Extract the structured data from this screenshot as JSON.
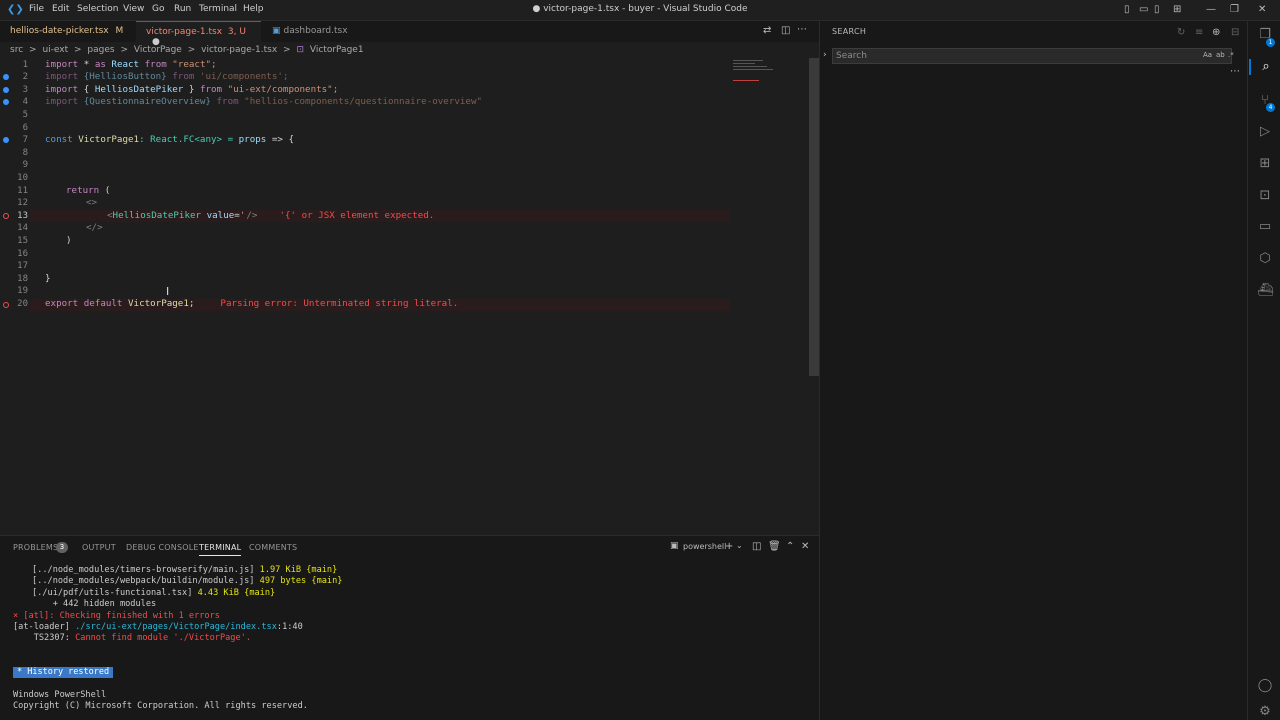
{
  "titlebar": {
    "menu": [
      "File",
      "Edit",
      "Selection",
      "View",
      "Go",
      "Run",
      "Terminal",
      "Help"
    ],
    "title": "● victor-page-1.tsx - buyer - Visual Studio Code"
  },
  "tabs": [
    {
      "label": "hellios-date-picker.tsx",
      "status": "M"
    },
    {
      "label": "victor-page-1.tsx",
      "status": "3, U",
      "dirty": "●"
    },
    {
      "label": "dashboard.tsx",
      "status": ""
    }
  ],
  "breadcrumb": [
    "src",
    ">",
    "ui-ext",
    ">",
    "pages",
    ">",
    "VictorPage",
    ">",
    "victor-page-1.tsx",
    ">",
    "VictorPage1"
  ],
  "editor": {
    "line_numbers": [
      "1",
      "2",
      "3",
      "4",
      "5",
      "6",
      "7",
      "8",
      "9",
      "10",
      "11",
      "12",
      "13",
      "14",
      "15",
      "16",
      "17",
      "18",
      "19",
      "20"
    ],
    "l1": {
      "a": "import",
      "b": " * ",
      "c": "as",
      "d": " React ",
      "e": "from",
      "f": " \"react\";"
    },
    "l2": {
      "a": "import",
      "b": " {HelliosButton} ",
      "c": "from",
      "d": " 'ui/components';"
    },
    "l3": {
      "a": "import",
      "b": " { ",
      "c": "HelliosDatePiker",
      "d": " } ",
      "e": "from",
      "f": " \"ui-ext/components\";"
    },
    "l4": {
      "a": "import",
      "b": " {QuestionnaireOverview} ",
      "c": "from",
      "d": " \"hellios-components/questionnaire-overview\""
    },
    "l7": {
      "a": "const",
      "b": " VictorPage1",
      "c": ": React.FC<any> = ",
      "d": "props",
      "e": " => {"
    },
    "l11": {
      "a": "return",
      "b": " ("
    },
    "l12": "<>",
    "l13": {
      "a": "<",
      "b": "HelliosDatePiker",
      "c": " value",
      "d": "=",
      "e": "'",
      "f": "/>"
    },
    "l13_error": "'{' or JSX element expected.",
    "l14": "</>",
    "l15": ")",
    "l18": "}",
    "l20": {
      "a": "export",
      "b": " default ",
      "c": "VictorPage1",
      "d": ";"
    },
    "l20_error": "Parsing error: Unterminated string literal."
  },
  "search": {
    "title": "SEARCH",
    "placeholder": "Search",
    "options": [
      "Aa",
      "ab",
      ".*"
    ]
  },
  "panel": {
    "tabs": [
      "PROBLEMS",
      "OUTPUT",
      "DEBUG CONSOLE",
      "TERMINAL",
      "COMMENTS"
    ],
    "problems_count": "3",
    "shell": "powershell",
    "terminal": {
      "l1": {
        "a": "[../node_modules/timers-browserify/main.js]",
        "b": " 1.97 KiB ",
        "c": "{main}"
      },
      "l2": {
        "a": "[../node_modules/webpack/buildin/module.js]",
        "b": " 497 bytes ",
        "c": "{main}"
      },
      "l3": {
        "a": "[./ui/pdf/utils-functional.tsx]",
        "b": " 4.43 KiB ",
        "c": "{main}"
      },
      "l4": "    + 442 hidden modules",
      "l5": {
        "a": "× [atl]",
        "b": ": Checking finished with 1 errors"
      },
      "l6": {
        "a": "[at-loader]",
        "b": " ./src/ui-ext/pages/VictorPage/index.tsx",
        "c": ":1:40"
      },
      "l7": {
        "a": "    TS2307: ",
        "b": "Cannot find module './VictorPage'."
      },
      "history": "*  History restored",
      "l8": "Windows PowerShell",
      "l9": "Copyright (C) Microsoft Corporation. All rights reserved."
    }
  },
  "colors": {
    "accent": "#0078d4",
    "error": "#f14c4c",
    "editor_bg": "#1e1e1e"
  }
}
